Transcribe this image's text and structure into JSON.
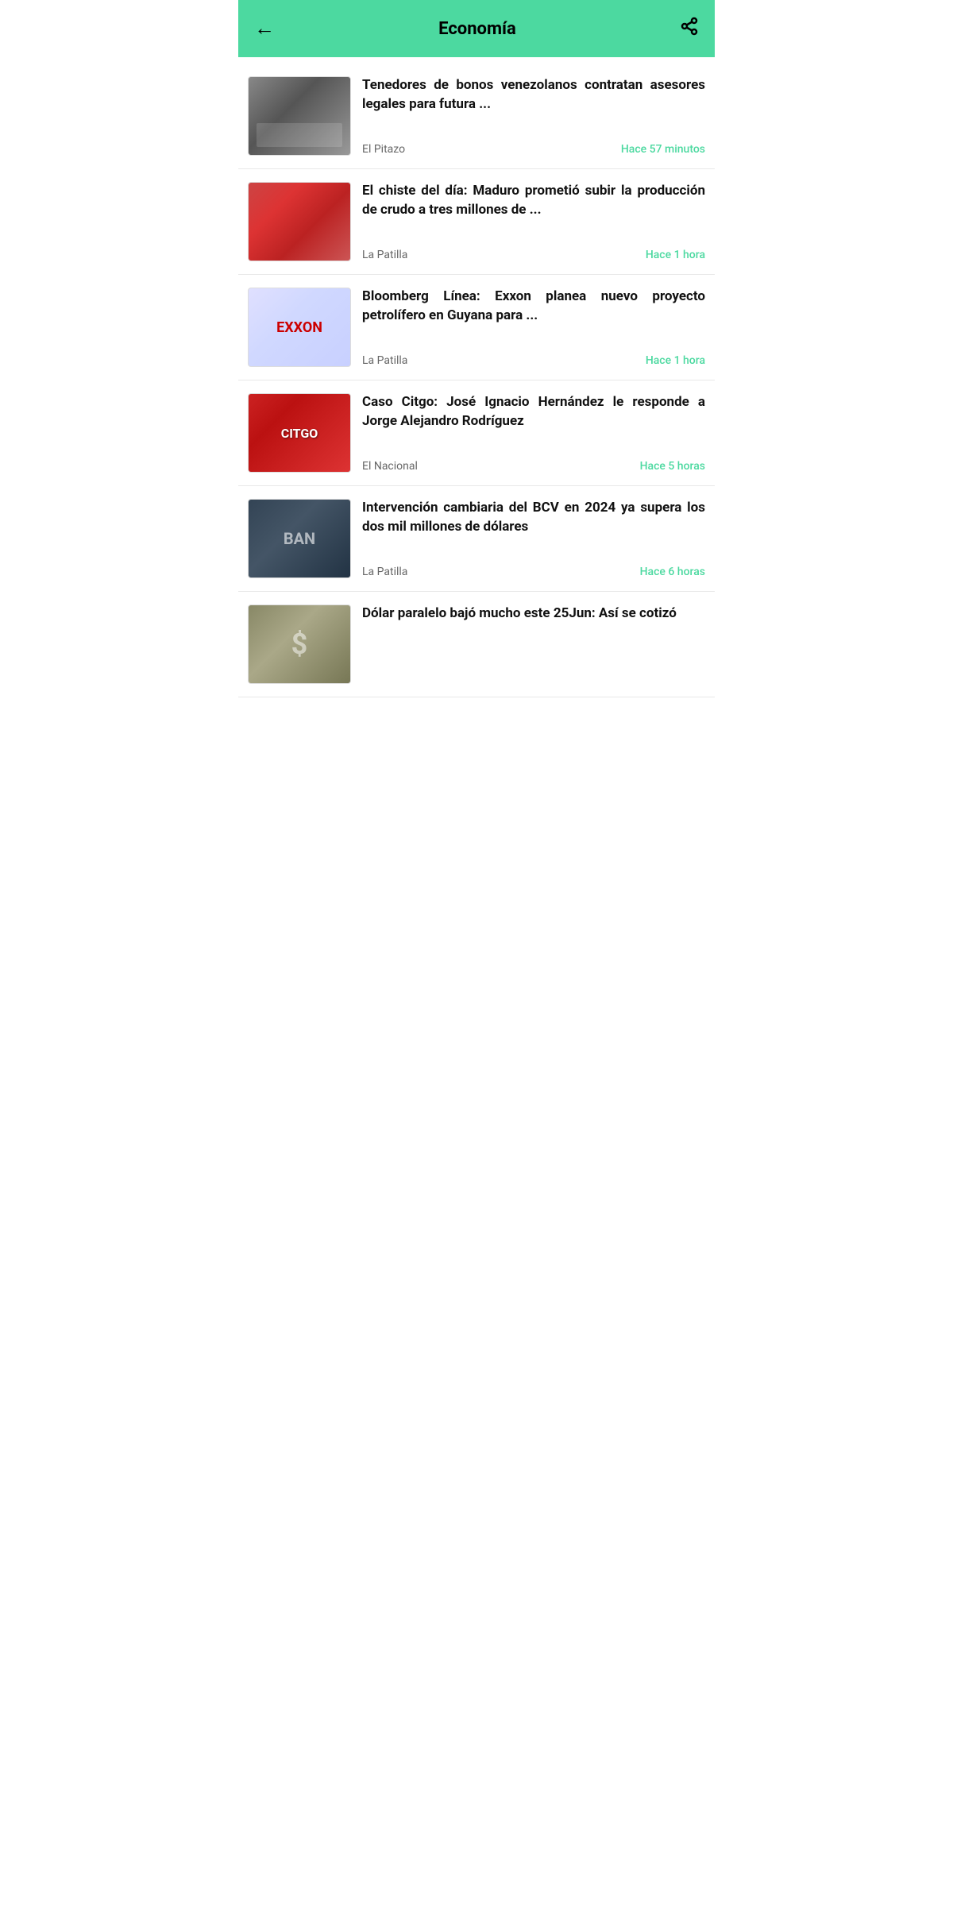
{
  "header": {
    "back_label": "←",
    "title": "Economía",
    "share_label": "⬡",
    "accent_color": "#4CD9A0"
  },
  "articles": [
    {
      "id": 1,
      "title": "Tenedores de bonos venezolanos contratan asesores legales para futura ...",
      "source": "El Pitazo",
      "time": "Hace 57 minutos",
      "thumb_class": "thumb-1"
    },
    {
      "id": 2,
      "title": "El chiste del día: Maduro prometió subir la producción de crudo a tres millones de ...",
      "source": "La Patilla",
      "time": "Hace 1 hora",
      "thumb_class": "thumb-2"
    },
    {
      "id": 3,
      "title": "Bloomberg Línea: Exxon planea nuevo proyecto petrolífero en Guyana para ...",
      "source": "La Patilla",
      "time": "Hace 1 hora",
      "thumb_class": "thumb-3"
    },
    {
      "id": 4,
      "title": "Caso Citgo: José Ignacio Hernández le responde a Jorge Alejandro Rodríguez",
      "source": "El Nacional",
      "time": "Hace 5 horas",
      "thumb_class": "thumb-4"
    },
    {
      "id": 5,
      "title": "Intervención cambiaria del BCV en 2024 ya supera los dos mil millones de dólares",
      "source": "La Patilla",
      "time": "Hace 6 horas",
      "thumb_class": "thumb-5"
    },
    {
      "id": 6,
      "title": "Dólar paralelo bajó mucho este 25Jun: Así se cotizó",
      "source": "",
      "time": "",
      "thumb_class": "thumb-6"
    }
  ]
}
